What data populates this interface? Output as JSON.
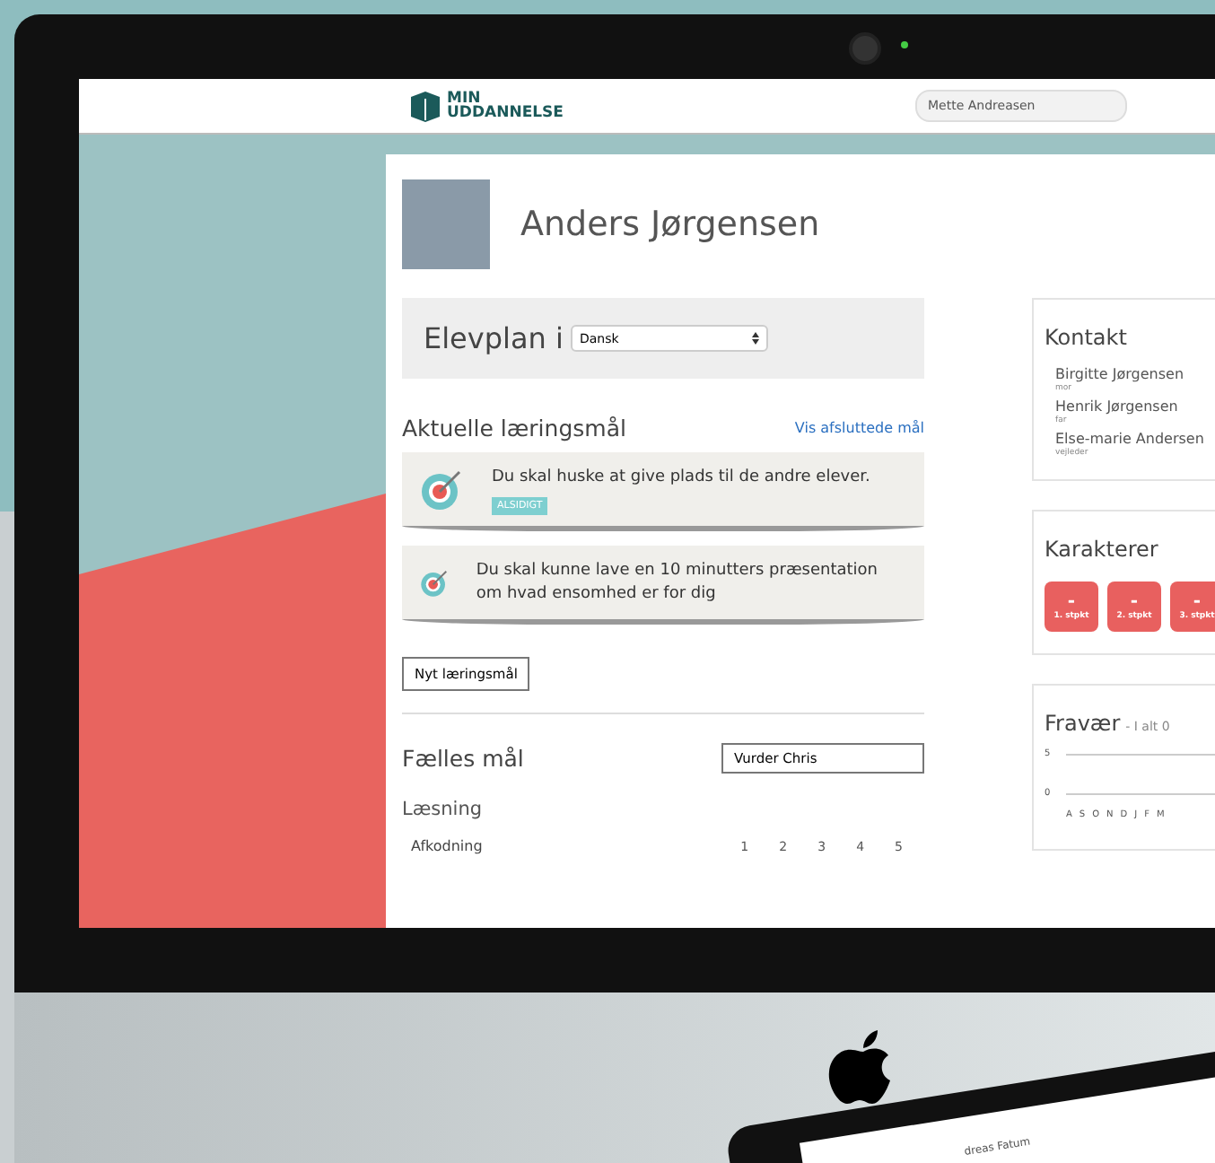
{
  "header": {
    "logo_line_1": "MIN",
    "logo_line_2": "UDDANNELSE",
    "user_field": "Mette Andreasen"
  },
  "student": {
    "name": "Anders Jørgensen"
  },
  "plan": {
    "title": "Elevplan i",
    "subject": "Dansk"
  },
  "goals_section": {
    "title": "Aktuelle læringsmål",
    "link": "Vis afsluttede mål"
  },
  "goals": [
    {
      "text": "Du skal huske at give plads til de andre elever.",
      "tag": "ALSIDIGT"
    },
    {
      "text": "Du skal kunne lave en 10 minutters præsentation om hvad ensomhed er for dig"
    }
  ],
  "new_goal_button": "Nyt læringsmål",
  "common_goals": {
    "title": "Fælles mål",
    "assess_field": "Vurder Chris",
    "area": "Læsning",
    "skill": "Afkodning",
    "scale": [
      "1",
      "2",
      "3",
      "4",
      "5"
    ]
  },
  "contacts": {
    "title": "Kontakt",
    "items": [
      {
        "name": "Birgitte Jørgensen",
        "role": "mor"
      },
      {
        "name": "Henrik Jørgensen",
        "role": "far"
      },
      {
        "name": "Else-marie Andersen",
        "role": "vejleder"
      }
    ]
  },
  "grades": {
    "title": "Karakterer",
    "items": [
      {
        "value": "-",
        "label": "1. stpkt"
      },
      {
        "value": "-",
        "label": "2. stpkt"
      },
      {
        "value": "-",
        "label": "3. stpkt"
      }
    ]
  },
  "absence": {
    "title": "Fravær",
    "total": "- I alt 0",
    "y_labels": [
      "5",
      "0"
    ],
    "months": [
      "A",
      "S",
      "O",
      "N",
      "D",
      "J",
      "F",
      "M"
    ]
  },
  "tablet": {
    "text": "dreas Fatum"
  }
}
